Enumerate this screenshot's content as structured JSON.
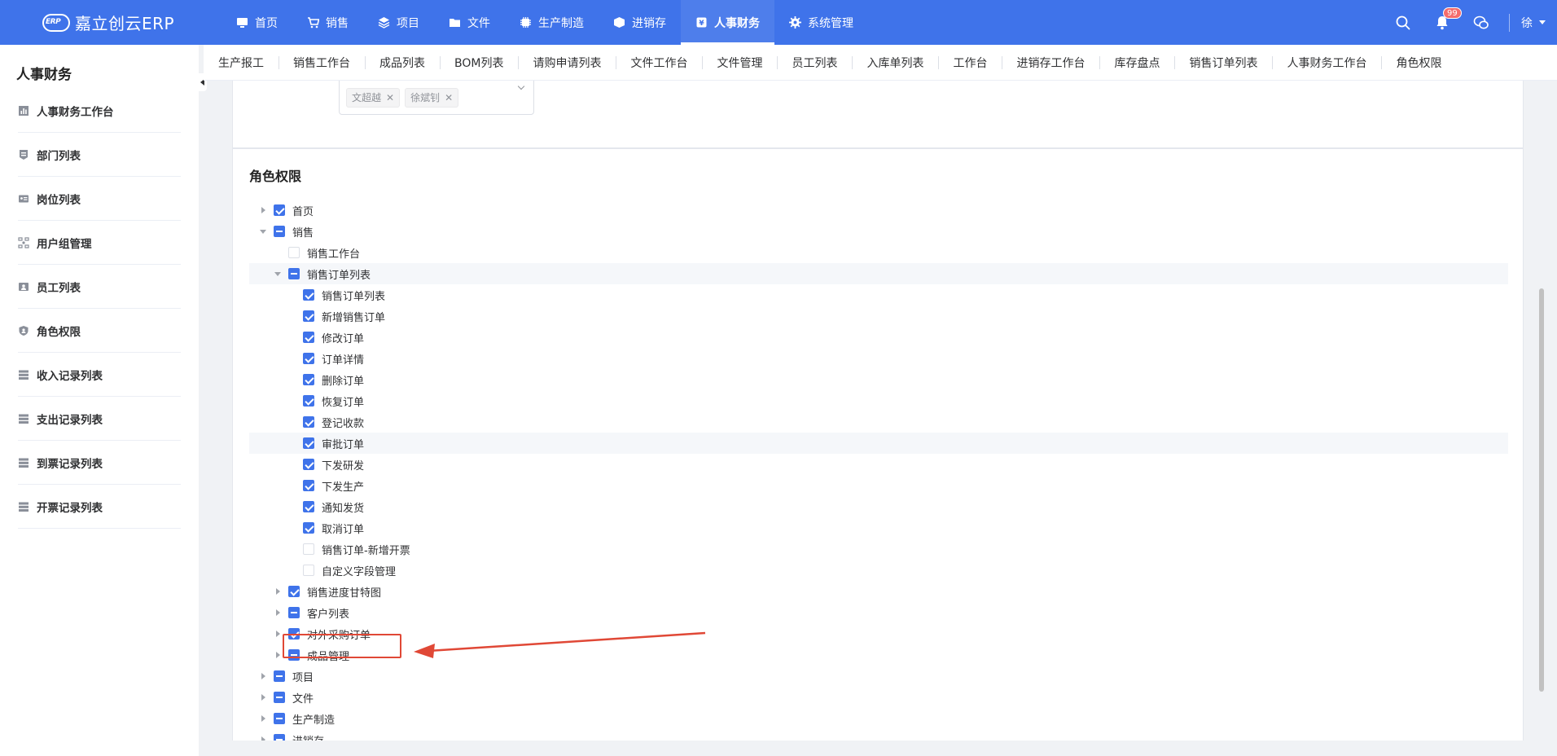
{
  "app": {
    "logo_mark": "ERP",
    "logo_text": "嘉立创云ERP"
  },
  "nav": [
    {
      "label": "首页",
      "icon": "monitor-icon"
    },
    {
      "label": "销售",
      "icon": "cart-icon"
    },
    {
      "label": "项目",
      "icon": "layers-icon"
    },
    {
      "label": "文件",
      "icon": "folder-icon"
    },
    {
      "label": "生产制造",
      "icon": "chip-icon"
    },
    {
      "label": "进销存",
      "icon": "box-icon"
    },
    {
      "label": "人事财务",
      "icon": "finance-icon",
      "active": true
    },
    {
      "label": "系统管理",
      "icon": "gear-icon"
    }
  ],
  "topright": {
    "badge_count": "99",
    "user": "徐"
  },
  "sidebar": {
    "title": "人事财务",
    "items": [
      {
        "label": "人事财务工作台",
        "icon": "chart-icon"
      },
      {
        "label": "部门列表",
        "icon": "department-icon"
      },
      {
        "label": "岗位列表",
        "icon": "id-card-icon"
      },
      {
        "label": "用户组管理",
        "icon": "user-group-icon"
      },
      {
        "label": "员工列表",
        "icon": "employee-icon"
      },
      {
        "label": "角色权限",
        "icon": "shield-icon"
      },
      {
        "label": "收入记录列表",
        "icon": "list-icon"
      },
      {
        "label": "支出记录列表",
        "icon": "list-icon"
      },
      {
        "label": "到票记录列表",
        "icon": "list-icon"
      },
      {
        "label": "开票记录列表",
        "icon": "list-icon"
      }
    ]
  },
  "tabs": [
    "生产报工",
    "销售工作台",
    "成品列表",
    "BOM列表",
    "请购申请列表",
    "文件工作台",
    "文件管理",
    "员工列表",
    "入库单列表",
    "工作台",
    "进销存工作台",
    "库存盘点",
    "销售订单列表",
    "人事财务工作台",
    "角色权限"
  ],
  "tagbox": {
    "tags": [
      "文超越",
      "徐斌钊"
    ]
  },
  "section_title": "角色权限",
  "tree": [
    {
      "label": "首页",
      "level": 0,
      "arrow": "right",
      "state": "checked"
    },
    {
      "label": "销售",
      "level": 0,
      "arrow": "down",
      "state": "partial"
    },
    {
      "label": "销售工作台",
      "level": 1,
      "arrow": "none",
      "state": "unchecked"
    },
    {
      "label": "销售订单列表",
      "level": 1,
      "arrow": "down",
      "state": "partial",
      "highlight": true
    },
    {
      "label": "销售订单列表",
      "level": 2,
      "arrow": "none",
      "state": "checked"
    },
    {
      "label": "新增销售订单",
      "level": 2,
      "arrow": "none",
      "state": "checked"
    },
    {
      "label": "修改订单",
      "level": 2,
      "arrow": "none",
      "state": "checked"
    },
    {
      "label": "订单详情",
      "level": 2,
      "arrow": "none",
      "state": "checked"
    },
    {
      "label": "删除订单",
      "level": 2,
      "arrow": "none",
      "state": "checked"
    },
    {
      "label": "恢复订单",
      "level": 2,
      "arrow": "none",
      "state": "checked"
    },
    {
      "label": "登记收款",
      "level": 2,
      "arrow": "none",
      "state": "checked"
    },
    {
      "label": "审批订单",
      "level": 2,
      "arrow": "none",
      "state": "checked",
      "highlight": true
    },
    {
      "label": "下发研发",
      "level": 2,
      "arrow": "none",
      "state": "checked"
    },
    {
      "label": "下发生产",
      "level": 2,
      "arrow": "none",
      "state": "checked"
    },
    {
      "label": "通知发货",
      "level": 2,
      "arrow": "none",
      "state": "checked"
    },
    {
      "label": "取消订单",
      "level": 2,
      "arrow": "none",
      "state": "checked"
    },
    {
      "label": "销售订单-新增开票",
      "level": 2,
      "arrow": "none",
      "state": "unchecked"
    },
    {
      "label": "自定义字段管理",
      "level": 2,
      "arrow": "none",
      "state": "unchecked"
    },
    {
      "label": "销售进度甘特图",
      "level": 1,
      "arrow": "right",
      "state": "checked"
    },
    {
      "label": "客户列表",
      "level": 1,
      "arrow": "right",
      "state": "partial"
    },
    {
      "label": "对外采购订单",
      "level": 1,
      "arrow": "right",
      "state": "checked"
    },
    {
      "label": "成品管理",
      "level": 1,
      "arrow": "right",
      "state": "partial"
    },
    {
      "label": "项目",
      "level": 0,
      "arrow": "right",
      "state": "partial"
    },
    {
      "label": "文件",
      "level": 0,
      "arrow": "right",
      "state": "partial"
    },
    {
      "label": "生产制造",
      "level": 0,
      "arrow": "right",
      "state": "partial"
    },
    {
      "label": "进销存",
      "level": 0,
      "arrow": "right",
      "state": "partial"
    }
  ],
  "colors": {
    "primary": "#3f73ea",
    "annotation": "#e04836"
  }
}
